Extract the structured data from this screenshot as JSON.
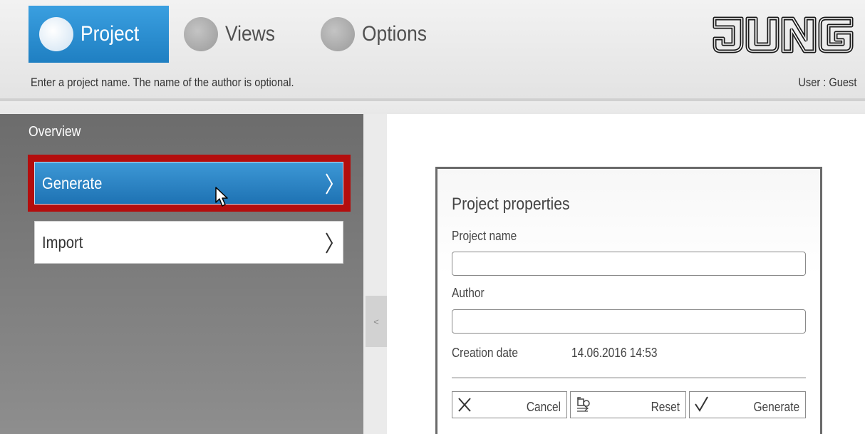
{
  "header": {
    "tabs": [
      {
        "label": "Project",
        "active": true
      },
      {
        "label": "Views",
        "active": false
      },
      {
        "label": "Options",
        "active": false
      }
    ],
    "logo_text": "JUNG",
    "hint": "Enter a project name. The name of the author is optional.",
    "user": "User : Guest"
  },
  "sidebar": {
    "title": "Overview",
    "items": [
      {
        "label": "Generate",
        "selected": true
      },
      {
        "label": "Import",
        "selected": false
      }
    ],
    "collapse_glyph": "<"
  },
  "card": {
    "title": "Project properties",
    "project_name_label": "Project name",
    "project_name_value": "",
    "author_label": "Author",
    "author_value": "",
    "creation_date_label": "Creation date",
    "creation_date_value": "14.06.2016 14:53",
    "buttons": {
      "cancel": "Cancel",
      "reset": "Reset",
      "generate": "Generate"
    }
  },
  "colors": {
    "accent": "#2a8ad0",
    "highlight_border": "#b30d0d",
    "sidebar_bg": "#7a7a7a"
  },
  "icons": {
    "tab_dot": "radio-dot-icon",
    "chevron": "chevron-right-icon",
    "cancel": "x-icon",
    "reset": "reset-icon",
    "generate": "checkmark-icon",
    "cursor": "mouse-pointer-icon"
  }
}
